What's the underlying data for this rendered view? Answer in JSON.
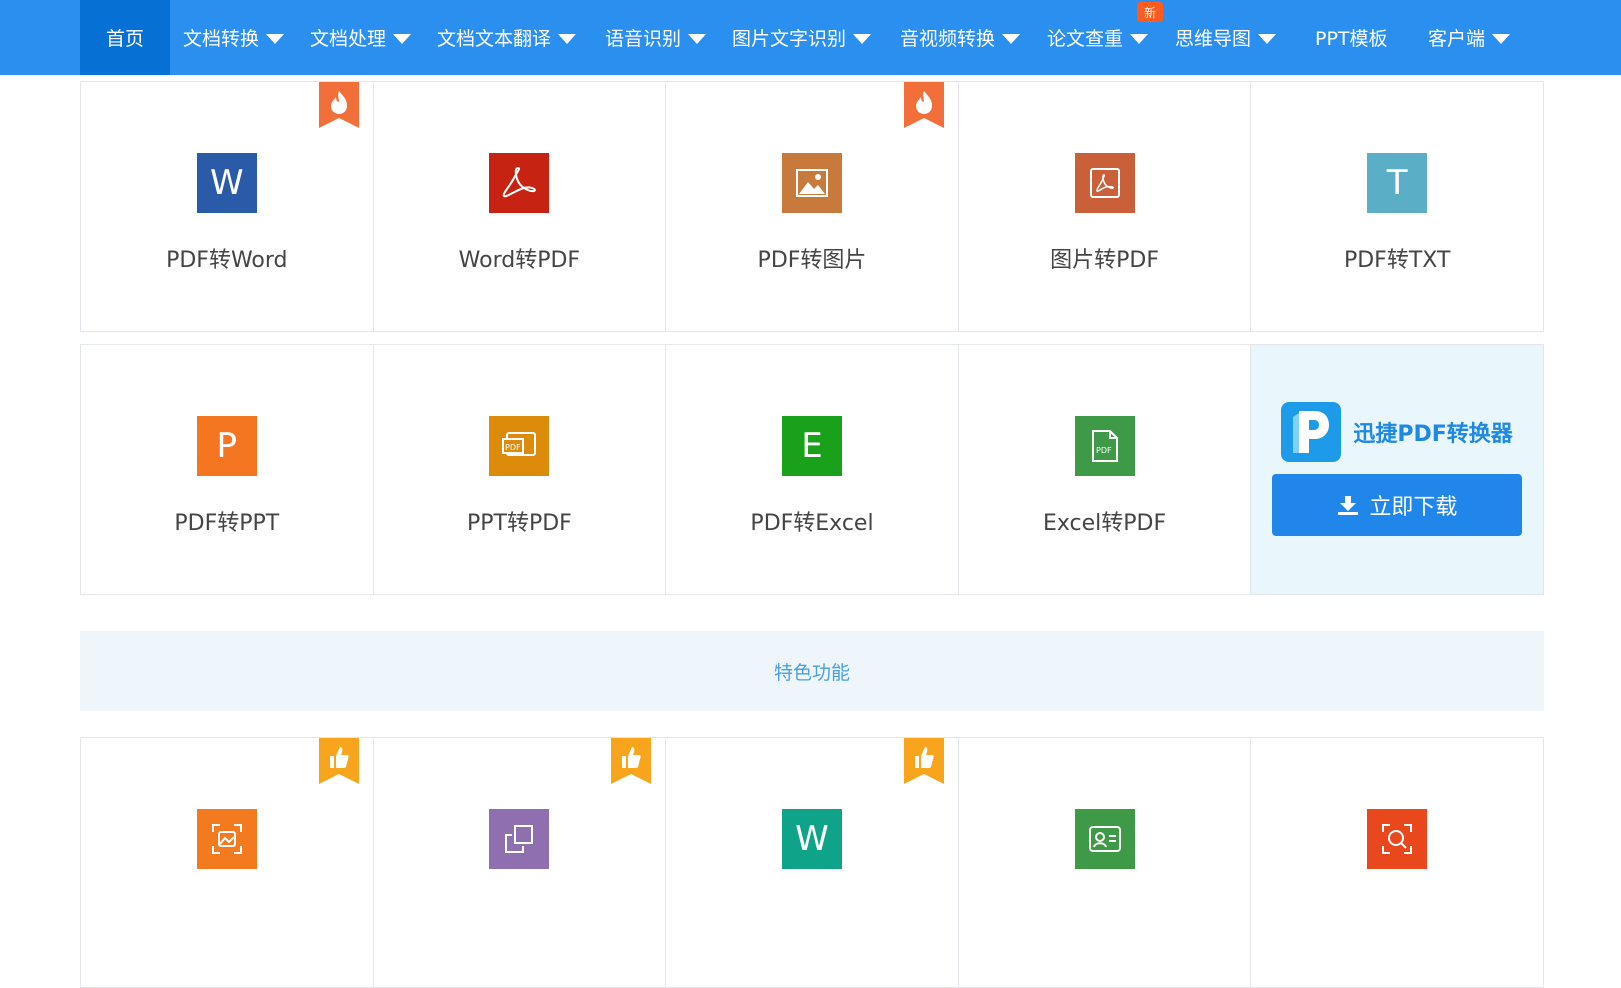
{
  "nav": {
    "items": [
      {
        "label": "首页",
        "active": true,
        "dropdown": false
      },
      {
        "label": "文档转换",
        "dropdown": true
      },
      {
        "label": "文档处理",
        "dropdown": true
      },
      {
        "label": "文档文本翻译",
        "dropdown": true
      },
      {
        "label": "语音识别",
        "dropdown": true
      },
      {
        "label": "图片文字识别",
        "dropdown": true
      },
      {
        "label": "音视频转换",
        "dropdown": true
      },
      {
        "label": "论文查重",
        "dropdown": true,
        "badge": "新"
      },
      {
        "label": "思维导图",
        "dropdown": true
      },
      {
        "label": "PPT模板",
        "dropdown": false
      },
      {
        "label": "客户端",
        "dropdown": true
      }
    ],
    "bg_color": "#2b8ff0",
    "active_color": "#0670d4"
  },
  "tools_row1": [
    {
      "label": "PDF转Word",
      "icon": "word-icon",
      "glyph": "W",
      "color": "#2a5ba9",
      "hot": true
    },
    {
      "label": "Word转PDF",
      "icon": "pdf-icon",
      "color": "#c62312",
      "hot": false
    },
    {
      "label": "PDF转图片",
      "icon": "image-icon",
      "color": "#c87a3c",
      "hot": true
    },
    {
      "label": "图片转PDF",
      "icon": "pdf-image-icon",
      "color": "#c9603a",
      "hot": false
    },
    {
      "label": "PDF转TXT",
      "icon": "txt-icon",
      "glyph": "T",
      "color": "#5aafc6",
      "hot": false
    }
  ],
  "tools_row2": [
    {
      "label": "PDF转PPT",
      "icon": "ppt-icon",
      "glyph": "P",
      "color": "#f47621"
    },
    {
      "label": "PPT转PDF",
      "icon": "ppt-pdf-icon",
      "color": "#dc8b0b"
    },
    {
      "label": "PDF转Excel",
      "icon": "excel-icon",
      "glyph": "E",
      "color": "#1aa11b"
    },
    {
      "label": "Excel转PDF",
      "icon": "excel-pdf-icon",
      "color": "#3f9a47"
    }
  ],
  "promo": {
    "name": "迅捷PDF转换器",
    "button": "立即下载"
  },
  "section": {
    "title": "特色功能"
  },
  "features": [
    {
      "icon": "image-scan-icon",
      "color": "#f47a20",
      "liked": true
    },
    {
      "icon": "resize-icon",
      "color": "#8f6fb0",
      "liked": true
    },
    {
      "icon": "word-icon",
      "glyph": "W",
      "color": "#0fa38a",
      "liked": true
    },
    {
      "icon": "id-card-icon",
      "color": "#3f9a47",
      "liked": false
    },
    {
      "icon": "search-scan-icon",
      "color": "#e8481c",
      "liked": false
    }
  ]
}
